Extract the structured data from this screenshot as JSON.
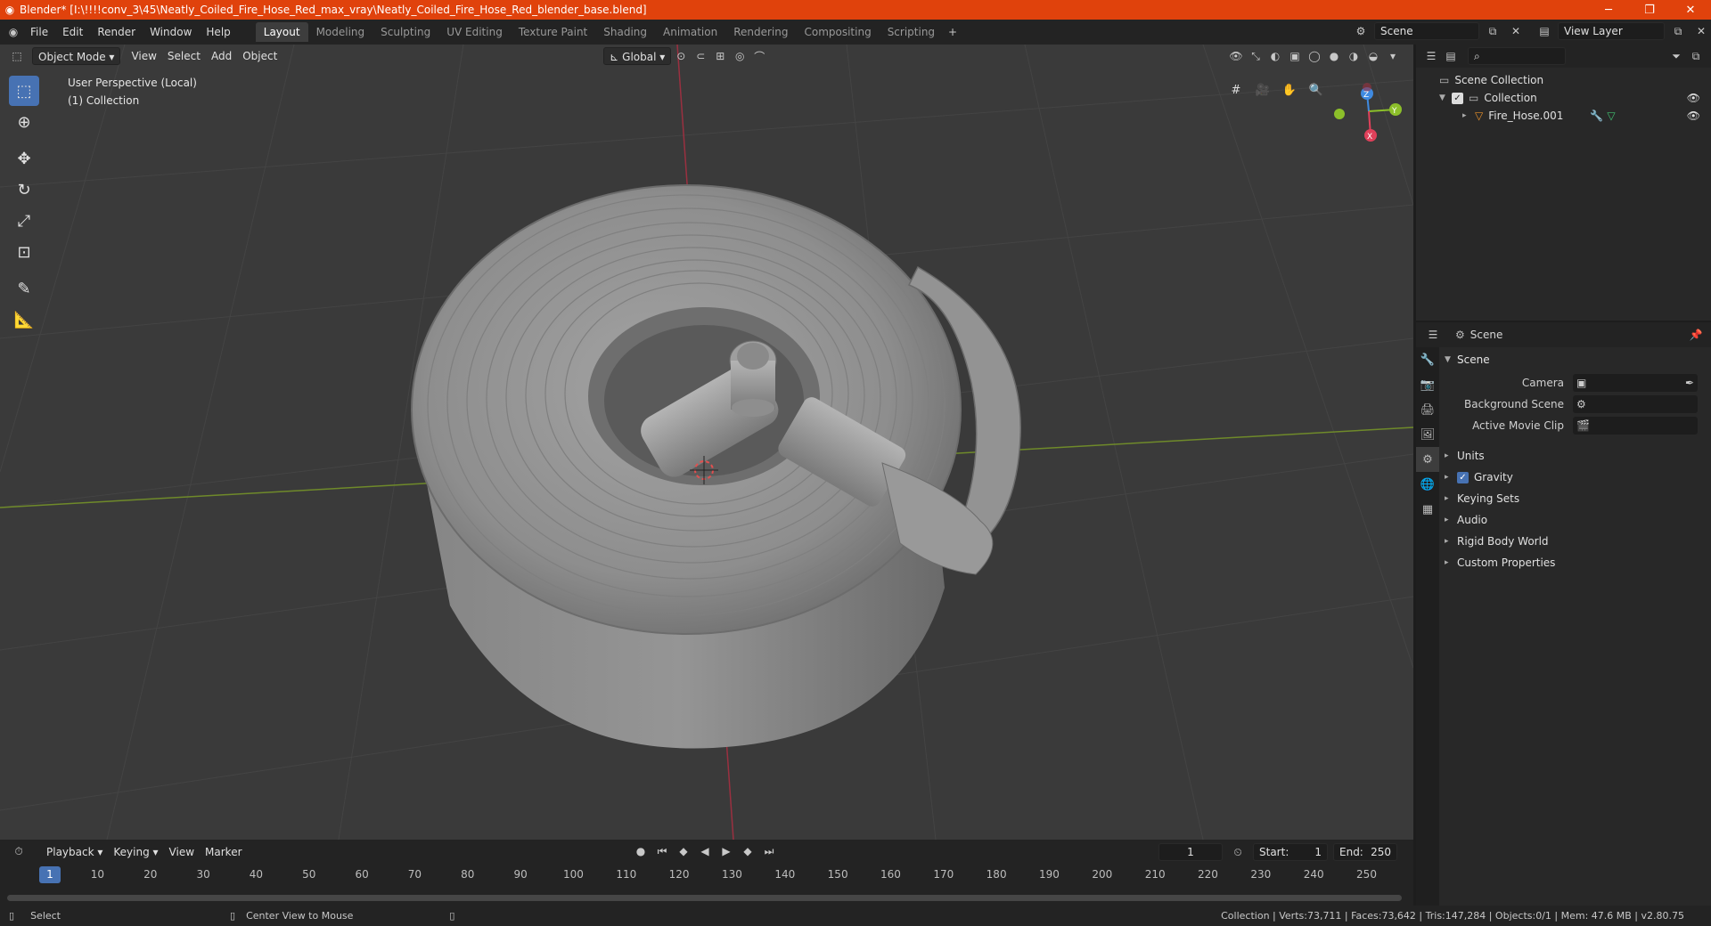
{
  "window": {
    "title": "Blender* [I:\\!!!!conv_3\\45\\Neatly_Coiled_Fire_Hose_Red_max_vray\\Neatly_Coiled_Fire_Hose_Red_blender_base.blend]"
  },
  "menu": [
    "File",
    "Edit",
    "Render",
    "Window",
    "Help"
  ],
  "workspaces": [
    "Layout",
    "Modeling",
    "Sculpting",
    "UV Editing",
    "Texture Paint",
    "Shading",
    "Animation",
    "Rendering",
    "Compositing",
    "Scripting"
  ],
  "active_workspace": "Layout",
  "scene_field": "Scene",
  "view_layer_field": "View Layer",
  "viewport": {
    "mode": "Object Mode",
    "menus": [
      "View",
      "Select",
      "Add",
      "Object"
    ],
    "orientation": "Global",
    "info_line1": "User Perspective (Local)",
    "info_line2": "(1) Collection",
    "gizmo": {
      "x": "X",
      "y": "Y",
      "z": "Z"
    }
  },
  "timeline": {
    "menus": [
      "Playback",
      "Keying",
      "View",
      "Marker"
    ],
    "current_frame": "1",
    "start_label": "Start:",
    "start": "1",
    "end_label": "End:",
    "end": "250",
    "ticks": [
      "10",
      "20",
      "30",
      "40",
      "50",
      "60",
      "70",
      "80",
      "90",
      "100",
      "110",
      "120",
      "130",
      "140",
      "150",
      "160",
      "170",
      "180",
      "190",
      "200",
      "210",
      "220",
      "230",
      "240",
      "250"
    ],
    "marker_frame": "1"
  },
  "status": {
    "left_action": "Select",
    "mid_action": "Center View to Mouse",
    "stats": "Collection | Verts:73,711 | Faces:73,642 | Tris:147,284 | Objects:0/1 | Mem: 47.6 MB | v2.80.75"
  },
  "outliner": {
    "root": "Scene Collection",
    "collection": "Collection",
    "object": "Fire_Hose.001"
  },
  "properties": {
    "header": "Scene",
    "panel": "Scene",
    "camera_label": "Camera",
    "bg_scene_label": "Background Scene",
    "movie_clip_label": "Active Movie Clip",
    "subpanels": [
      "Units",
      "Gravity",
      "Keying Sets",
      "Audio",
      "Rigid Body World",
      "Custom Properties"
    ]
  },
  "colors": {
    "titlebar": "#e0420c",
    "accent": "#4772b3",
    "x_axis": "#e0405a",
    "y_axis": "#8cbf2a",
    "z_axis": "#3f8ae0"
  }
}
